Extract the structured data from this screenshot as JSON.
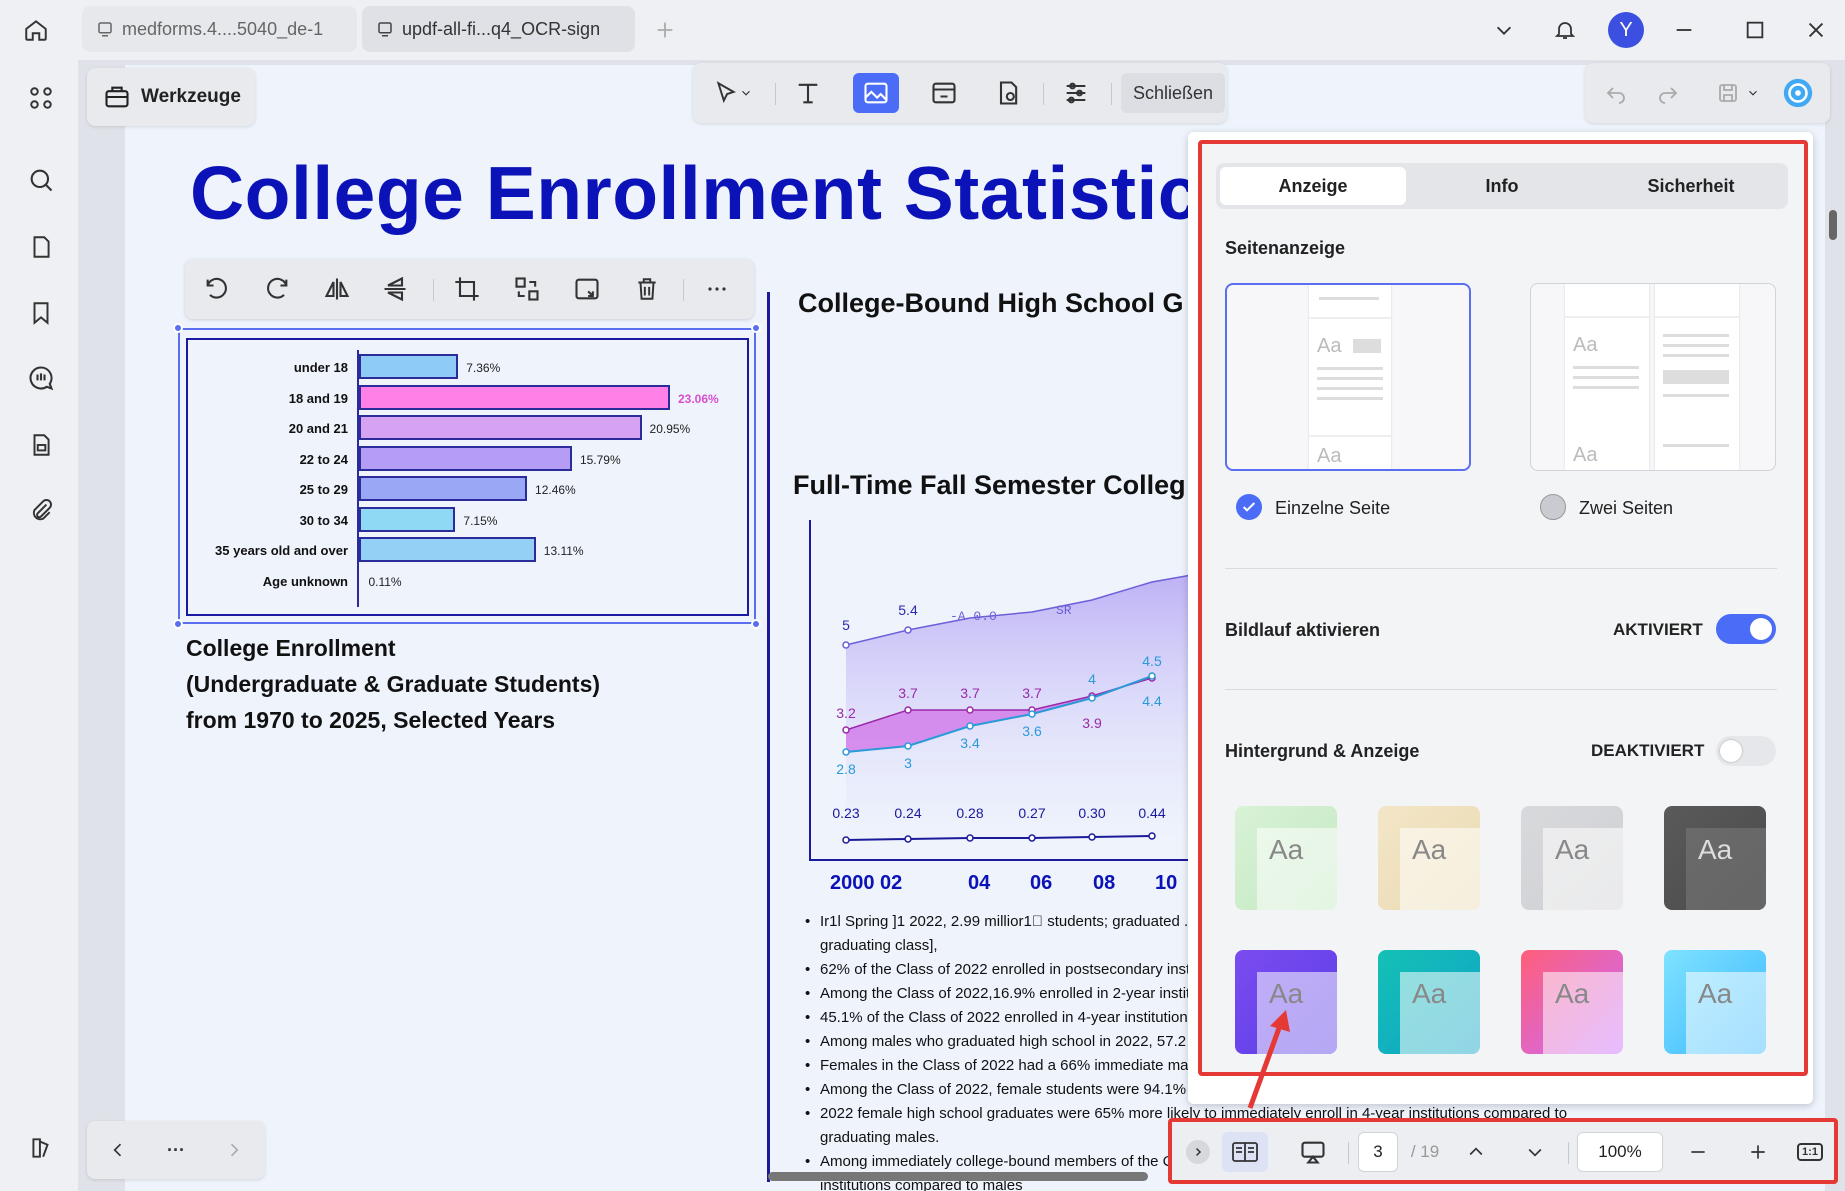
{
  "tabs": [
    {
      "label": "medforms.4....5040_de-1"
    },
    {
      "label": "updf-all-fi...q4_OCR-sign"
    }
  ],
  "user": {
    "avatar_letter": "Y"
  },
  "werkzeuge_label": "Werkzeuge",
  "toolbar": {
    "close_label": "Schließen"
  },
  "document": {
    "title": "College Enrollment Statistics",
    "caption_lines": [
      "College Enrollment",
      "(Undergraduate & Graduate Students)",
      "from 1970 to 2025, Selected Years"
    ],
    "heading1": "College-Bound High School G",
    "heading2": "Full-Time Fall Semester Colleg",
    "bullets": [
      "Ir1l Spring ]1 2022, 2.99 millior1\u0000 studen­ts; graduated ...",
      "graduating class],",
      "62% of the Class of 2022 enrolled in postsecondary inst",
      "Among the Class of 2022,16.9% enrolled in 2-year instit",
      "45.1% of the Class of 2022 enrolled in 4-year institution",
      "Among males who graduated high school in 2022, 57.2",
      "Females in the Class of 2022 had a 66% immediate ma",
      "Among the Class of 2022, female students were 94.1%",
      "2022 female high school graduates were 65% more likely to immediately enroll in 4-year institutions compared to",
      "graduating males.",
      "Among immediately college-bound members of the C",
      "institutions compared to males"
    ]
  },
  "chart_data": [
    {
      "type": "bar",
      "categories": [
        "under 18",
        "18 and 19",
        "20 and 21",
        "22 to 24",
        "25 to 29",
        "30 to 34",
        "35 years old and over",
        "Age unknown"
      ],
      "values": [
        7.36,
        23.06,
        20.95,
        15.79,
        12.46,
        7.15,
        13.11,
        0.11
      ],
      "value_labels": [
        "7.36%",
        "23.06%",
        "20.95%",
        "15.79%",
        "12.46%",
        "7.15%",
        "13.11%",
        "0.11%"
      ],
      "colors": [
        "#8ecbf5",
        "#ff80e6",
        "#d6a3f2",
        "#b59cf5",
        "#9aa7f5",
        "#8fd9f5",
        "#94d0f5",
        "#2b2b9a"
      ]
    },
    {
      "type": "area",
      "categories": [
        "2000",
        "02",
        "04",
        "06",
        "08",
        "10"
      ],
      "x_tick_labels": [
        "2000 02",
        "04",
        "06",
        "08",
        "10"
      ],
      "series": [
        {
          "values": [
            5,
            5.4,
            null,
            null,
            null,
            null
          ],
          "labels": [
            "5",
            "5.4"
          ]
        },
        {
          "values": [
            3.2,
            3.7,
            3.7,
            3.7,
            3.9,
            4.4
          ],
          "labels": [
            "3.2",
            "3.7",
            "3.7",
            "3.7",
            "3.9",
            "4.4"
          ]
        },
        {
          "values": [
            2.8,
            3,
            3.4,
            3.6,
            4,
            4.5
          ],
          "labels": [
            "2.8",
            "3",
            "3.4",
            "3.6",
            "4",
            "4.5"
          ]
        },
        {
          "values": [
            0.23,
            0.24,
            0.28,
            0.27,
            0.3,
            0.44
          ],
          "labels": [
            "0.23",
            "0.24",
            "0.28",
            "0.27",
            "0.30",
            "0.44"
          ]
        }
      ],
      "annotations": [
        "-A 0.0",
        "SR"
      ]
    }
  ],
  "panel": {
    "tabs": [
      "Anzeige",
      "Info",
      "Sicherheit"
    ],
    "seitenanzeige_title": "Seitenanzeige",
    "single_page": "Einzelne Seite",
    "two_pages": "Zwei Seiten",
    "scroll_title": "Bildlauf aktivieren",
    "scroll_status": "AKTIVIERT",
    "bg_title": "Hintergrund & Anzeige",
    "bg_status": "DEAKTIVIERT",
    "theme_aa": "Aa"
  },
  "bottom": {
    "page_current": "3",
    "page_total": "/ 19",
    "zoom": "100%",
    "fit_label": "1:1",
    "nav_more": "···"
  },
  "colors": {
    "accent": "#4a6cf7",
    "highlight": "#e53935",
    "title_blue": "#0a12b8"
  }
}
